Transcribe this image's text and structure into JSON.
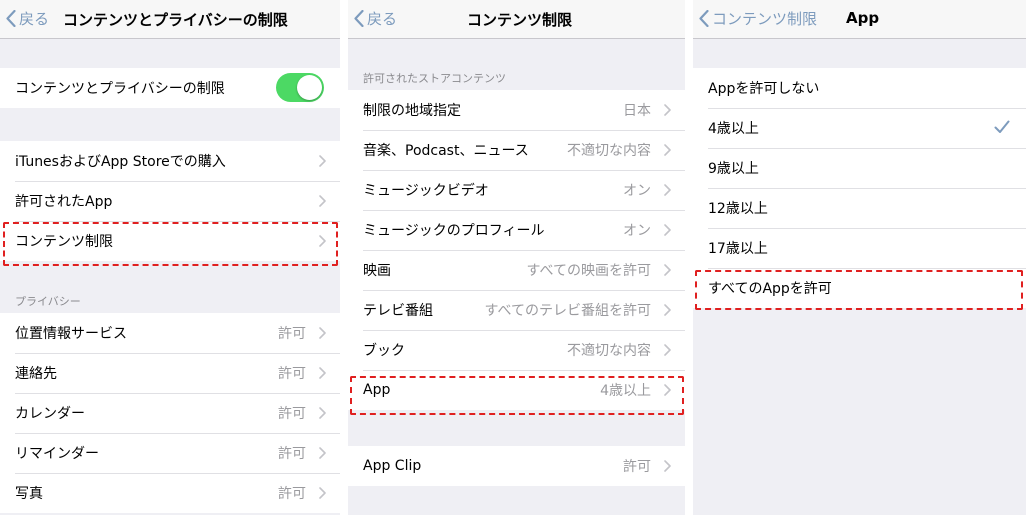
{
  "panel1": {
    "back": "戻る",
    "title": "コンテンツとプライバシーの制限",
    "toggle_row": {
      "label": "コンテンツとプライバシーの制限",
      "on": true
    },
    "rows": [
      {
        "label": "iTunesおよびApp Storeでの購入"
      },
      {
        "label": "許可されたApp"
      },
      {
        "label": "コンテンツ制限"
      }
    ],
    "privacy_header": "プライバシー",
    "privacy_rows": [
      {
        "label": "位置情報サービス",
        "value": "許可"
      },
      {
        "label": "連絡先",
        "value": "許可"
      },
      {
        "label": "カレンダー",
        "value": "許可"
      },
      {
        "label": "リマインダー",
        "value": "許可"
      },
      {
        "label": "写真",
        "value": "許可"
      }
    ]
  },
  "panel2": {
    "back": "戻る",
    "title": "コンテンツ制限",
    "section_header": "許可されたストアコンテンツ",
    "rows": [
      {
        "label": "制限の地域指定",
        "value": "日本"
      },
      {
        "label": "音楽、Podcast、ニュース",
        "value": "不適切な内容"
      },
      {
        "label": "ミュージックビデオ",
        "value": "オン"
      },
      {
        "label": "ミュージックのプロフィール",
        "value": "オン"
      },
      {
        "label": "映画",
        "value": "すべての映画を許可"
      },
      {
        "label": "テレビ番組",
        "value": "すべてのテレビ番組を許可"
      },
      {
        "label": "ブック",
        "value": "不適切な内容"
      },
      {
        "label": "App",
        "value": "4歳以上"
      }
    ],
    "appclip": {
      "label": "App Clip",
      "value": "許可"
    }
  },
  "panel3": {
    "back": "コンテンツ制限",
    "title": "App",
    "options": [
      {
        "label": "Appを許可しない",
        "selected": false
      },
      {
        "label": "4歳以上",
        "selected": true
      },
      {
        "label": "9歳以上",
        "selected": false
      },
      {
        "label": "12歳以上",
        "selected": false
      },
      {
        "label": "17歳以上",
        "selected": false
      },
      {
        "label": "すべてのAppを許可",
        "selected": false
      }
    ]
  },
  "colors": {
    "accent": "#7d9bbd",
    "toggle_on": "#4cd964",
    "highlight": "#e02020",
    "background": "#efeff4"
  }
}
